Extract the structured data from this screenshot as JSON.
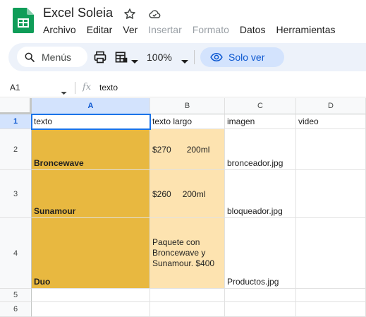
{
  "app": {
    "title": "Excel Soleia",
    "brand_color": "#0f9d58"
  },
  "menu": [
    {
      "label": "Archivo",
      "enabled": true
    },
    {
      "label": "Editar",
      "enabled": true
    },
    {
      "label": "Ver",
      "enabled": true
    },
    {
      "label": "Insertar",
      "enabled": false
    },
    {
      "label": "Formato",
      "enabled": false
    },
    {
      "label": "Datos",
      "enabled": true
    },
    {
      "label": "Herramientas",
      "enabled": true
    }
  ],
  "toolbar": {
    "search_label": "Menús",
    "zoom": "100%",
    "view_only_label": "Solo ver"
  },
  "formula_bar": {
    "cell_ref": "A1",
    "fx": "fx",
    "content": "texto"
  },
  "columns": [
    "A",
    "B",
    "C",
    "D"
  ],
  "rows": [
    "1",
    "2",
    "3",
    "4",
    "5",
    "6"
  ],
  "cells": {
    "r1": {
      "a": "texto",
      "b": "texto largo",
      "c": "imagen",
      "d": "video"
    },
    "r2": {
      "a": "Broncewave",
      "b_price": "$270",
      "b_size": "200ml",
      "c": "bronceador.jpg",
      "d": ""
    },
    "r3": {
      "a": "Sunamour",
      "b_price": "$260",
      "b_size": "200ml",
      "c": "bloqueador.jpg",
      "d": ""
    },
    "r4": {
      "a": "Duo",
      "b": "Paquete con Broncewave y Sunamour. $400",
      "c": "Productos.jpg",
      "d": ""
    }
  },
  "colors": {
    "accent": "#1a73e8",
    "gold_fill": "#e8b840",
    "peach_fill": "#fde3b0",
    "view_only_bg": "#d3e3fd"
  }
}
